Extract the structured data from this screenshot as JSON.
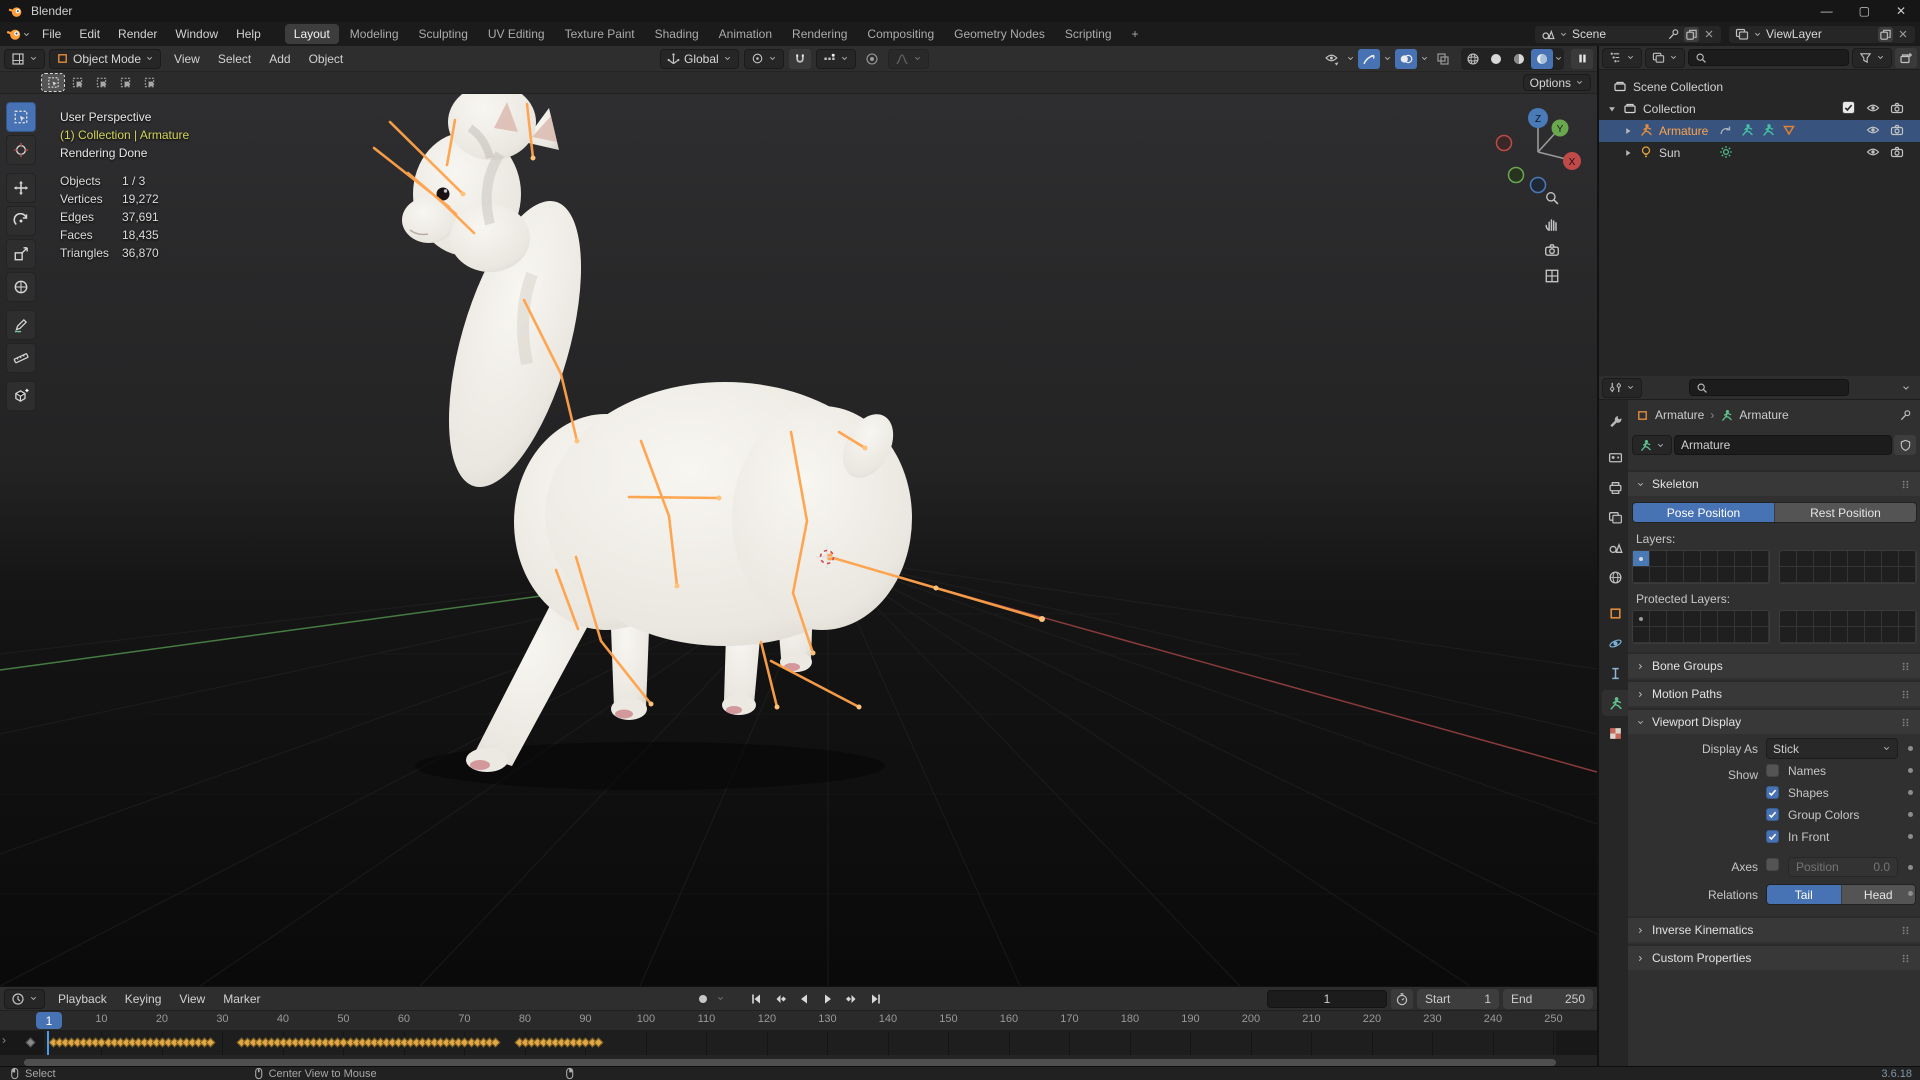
{
  "window": {
    "title": "Blender"
  },
  "menubar": {
    "menus": [
      "File",
      "Edit",
      "Render",
      "Window",
      "Help"
    ],
    "workspaces": [
      "Layout",
      "Modeling",
      "Sculpting",
      "UV Editing",
      "Texture Paint",
      "Shading",
      "Animation",
      "Rendering",
      "Compositing",
      "Geometry Nodes",
      "Scripting"
    ],
    "active_workspace": "Layout",
    "add_workspace_label": "+",
    "scene_selector": {
      "value": "Scene"
    },
    "view_layer_selector": {
      "value": "ViewLayer"
    }
  },
  "viewport": {
    "header": {
      "mode": "Object Mode",
      "menus": [
        "View",
        "Select",
        "Add",
        "Object"
      ],
      "orientation": "Global"
    },
    "tool_settings": {
      "options_label": "Options"
    },
    "overlay": {
      "view_label": "User Perspective",
      "context_label": "(1) Collection | Armature",
      "render_status": "Rendering Done",
      "stats": [
        {
          "label": "Objects",
          "value": "1 / 3"
        },
        {
          "label": "Vertices",
          "value": "19,272"
        },
        {
          "label": "Edges",
          "value": "37,691"
        },
        {
          "label": "Faces",
          "value": "18,435"
        },
        {
          "label": "Triangles",
          "value": "36,870"
        }
      ]
    },
    "gizmo_axes": {
      "x": "X",
      "y": "Y",
      "z": "Z"
    },
    "tools": [
      "select-box",
      "cursor",
      "move",
      "rotate",
      "scale",
      "transform",
      "annotate",
      "measure",
      "add-cube"
    ],
    "active_tool": "select-box"
  },
  "outliner": {
    "rows": [
      {
        "label": "Scene Collection",
        "icon": "collection",
        "indent": 0,
        "disclosure": "none",
        "right": [],
        "badges": [],
        "selected": false
      },
      {
        "label": "Collection",
        "icon": "collection",
        "indent": 1,
        "disclosure": "open",
        "right": [
          "checkbox",
          "eye",
          "camera"
        ],
        "badges": [],
        "selected": false
      },
      {
        "label": "Armature",
        "icon": "armature",
        "indent": 2,
        "disclosure": "closed",
        "right": [
          "eye",
          "camera"
        ],
        "badges": [
          "animation",
          "pose",
          "pose",
          "custom-shape"
        ],
        "selected": true
      },
      {
        "label": "Sun",
        "icon": "light",
        "indent": 2,
        "disclosure": "closed",
        "right": [
          "eye",
          "camera"
        ],
        "badges": [
          "sun"
        ],
        "selected": false
      }
    ]
  },
  "properties": {
    "tabs": [
      "tool",
      "render",
      "output",
      "view-layer",
      "scene",
      "world",
      "object",
      "physics",
      "constraints",
      "object-data",
      "texture"
    ],
    "active_tab": "object-data",
    "breadcrumb": {
      "object": "Armature",
      "separator": "›",
      "data": "Armature"
    },
    "name_field": "Armature",
    "skeleton": {
      "title": "Skeleton",
      "pose_button": "Pose Position",
      "rest_button": "Rest Position",
      "active_position": "Pose Position",
      "layers_label": "Layers:",
      "protected_layers_label": "Protected Layers:"
    },
    "collapsed_panels_top": [
      "Bone Groups",
      "Motion Paths"
    ],
    "viewport_display": {
      "title": "Viewport Display",
      "display_as_label": "Display As",
      "display_as_value": "Stick",
      "show_label": "Show",
      "toggles": [
        {
          "label": "Names",
          "checked": false
        },
        {
          "label": "Shapes",
          "checked": true
        },
        {
          "label": "Group Colors",
          "checked": true
        },
        {
          "label": "In Front",
          "checked": true
        }
      ],
      "axes_label": "Axes",
      "axes_checked": false,
      "position_label": "Position",
      "position_value": "0.0",
      "relations_label": "Relations",
      "relations_options": [
        "Tail",
        "Head"
      ],
      "relations_active": "Tail"
    },
    "collapsed_panels_bottom": [
      "Inverse Kinematics",
      "Custom Properties"
    ]
  },
  "timeline": {
    "menus": [
      "Playback",
      "Keying",
      "View",
      "Marker"
    ],
    "current_frame": "1",
    "frame_field_value": "1",
    "start_label": "Start",
    "start_value": "1",
    "end_label": "End",
    "end_value": "250",
    "ruler_ticks": [
      10,
      20,
      30,
      40,
      50,
      60,
      70,
      80,
      90,
      100,
      110,
      120,
      130,
      140,
      150,
      160,
      170,
      180,
      190,
      200,
      210,
      220,
      230,
      240,
      250
    ],
    "keyframe_segments": [
      [
        2,
        28
      ],
      [
        33,
        75
      ],
      [
        79,
        92
      ]
    ]
  },
  "statusbar": {
    "items": [
      {
        "icon": "mouse-left",
        "label": "Select"
      },
      {
        "icon": "mouse-middle",
        "label": "Center View to Mouse"
      },
      {
        "icon": "mouse-right",
        "label": ""
      }
    ],
    "version": "3.6.18"
  },
  "colors": {
    "accent": "#4772b3",
    "selected_text_orange": "#ffa24a",
    "bone_orange": "#ffa24a",
    "keyframe_orange": "#e2a847",
    "context_yellow": "#d6d65a",
    "axis_green": "#4f8f4a",
    "axis_red": "#9e4343"
  }
}
